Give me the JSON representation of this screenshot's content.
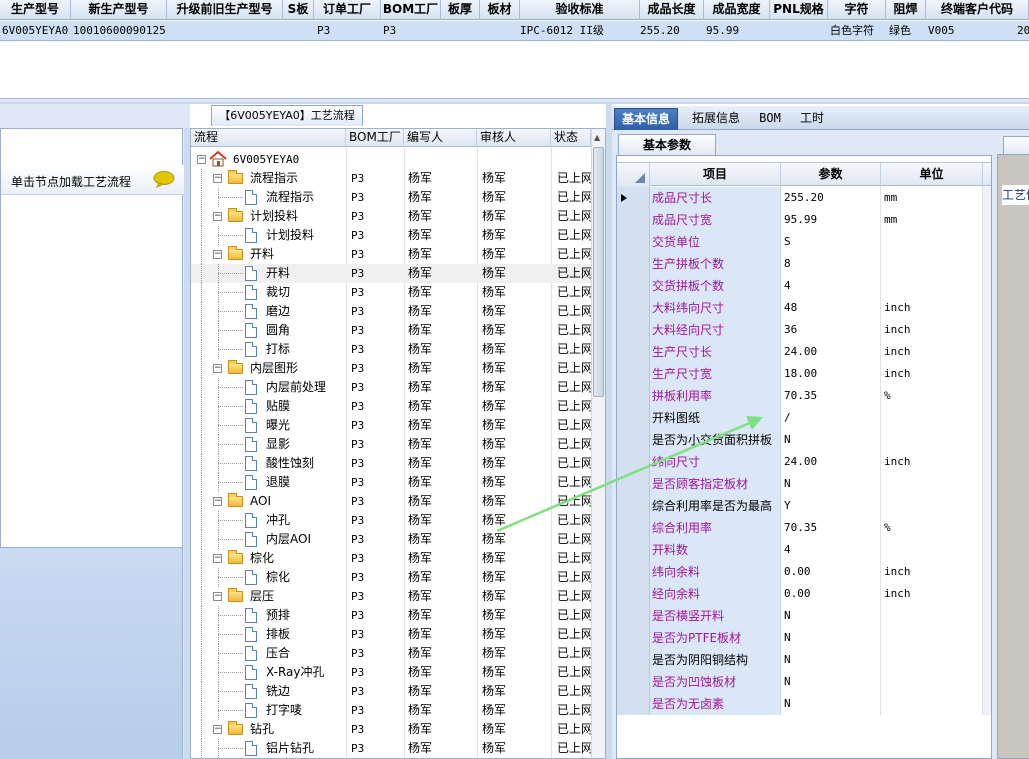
{
  "top_grid": {
    "columns": [
      "生产型号",
      "新生产型号",
      "升级前旧生产型号",
      "S板",
      "订单工厂",
      "BOM工厂",
      "板厚",
      "板材",
      "验收标准",
      "成品长度",
      "成品宽度",
      "PNL规格",
      "字符",
      "阻焊",
      "终端客户代码"
    ],
    "row": {
      "prod_model": "6V005YEYA0",
      "new_model": "10010600090125",
      "old_model": "",
      "s_board": "",
      "order_factory": "P3",
      "bom_factory": "P3",
      "thickness": "",
      "material": "",
      "standard": "IPC-6012 II级",
      "length": "255.20",
      "width": "95.99",
      "pnl": "",
      "char": "白色字符",
      "solder_mask": "绿色",
      "customer_code": "V005",
      "overflow": "20"
    }
  },
  "left_panel": {
    "load_label": "单击节点加载工艺流程",
    "icon": "chat-bubble-icon"
  },
  "process_panel": {
    "title": "【6V005YEYA0】工艺流程",
    "columns": [
      "流程",
      "BOM工厂",
      "编写人",
      "审核人",
      "状态"
    ],
    "root_label": "6V005YEYA0",
    "rows": [
      {
        "label": "流程指示",
        "level": 1,
        "bom": "P3",
        "author": "杨军",
        "reviewer": "杨军",
        "status": "已上网"
      },
      {
        "label": "流程指示",
        "level": 2,
        "bom": "P3",
        "author": "杨军",
        "reviewer": "杨军",
        "status": "已上网"
      },
      {
        "label": "计划投料",
        "level": 1,
        "bom": "P3",
        "author": "杨军",
        "reviewer": "杨军",
        "status": "已上网"
      },
      {
        "label": "计划投料",
        "level": 2,
        "bom": "P3",
        "author": "杨军",
        "reviewer": "杨军",
        "status": "已上网"
      },
      {
        "label": "开料",
        "level": 1,
        "bom": "P3",
        "author": "杨军",
        "reviewer": "杨军",
        "status": "已上网"
      },
      {
        "label": "开料",
        "level": 2,
        "bom": "P3",
        "author": "杨军",
        "reviewer": "杨军",
        "status": "已上网",
        "selected": true
      },
      {
        "label": "裁切",
        "level": 2,
        "bom": "P3",
        "author": "杨军",
        "reviewer": "杨军",
        "status": "已上网"
      },
      {
        "label": "磨边",
        "level": 2,
        "bom": "P3",
        "author": "杨军",
        "reviewer": "杨军",
        "status": "已上网"
      },
      {
        "label": "圆角",
        "level": 2,
        "bom": "P3",
        "author": "杨军",
        "reviewer": "杨军",
        "status": "已上网"
      },
      {
        "label": "打标",
        "level": 2,
        "bom": "P3",
        "author": "杨军",
        "reviewer": "杨军",
        "status": "已上网"
      },
      {
        "label": "内层图形",
        "level": 1,
        "bom": "P3",
        "author": "杨军",
        "reviewer": "杨军",
        "status": "已上网"
      },
      {
        "label": "内层前处理",
        "level": 2,
        "bom": "P3",
        "author": "杨军",
        "reviewer": "杨军",
        "status": "已上网"
      },
      {
        "label": "贴膜",
        "level": 2,
        "bom": "P3",
        "author": "杨军",
        "reviewer": "杨军",
        "status": "已上网"
      },
      {
        "label": "曝光",
        "level": 2,
        "bom": "P3",
        "author": "杨军",
        "reviewer": "杨军",
        "status": "已上网"
      },
      {
        "label": "显影",
        "level": 2,
        "bom": "P3",
        "author": "杨军",
        "reviewer": "杨军",
        "status": "已上网"
      },
      {
        "label": "酸性蚀刻",
        "level": 2,
        "bom": "P3",
        "author": "杨军",
        "reviewer": "杨军",
        "status": "已上网"
      },
      {
        "label": "退膜",
        "level": 2,
        "bom": "P3",
        "author": "杨军",
        "reviewer": "杨军",
        "status": "已上网"
      },
      {
        "label": "AOI",
        "level": 1,
        "bom": "P3",
        "author": "杨军",
        "reviewer": "杨军",
        "status": "已上网"
      },
      {
        "label": "冲孔",
        "level": 2,
        "bom": "P3",
        "author": "杨军",
        "reviewer": "杨军",
        "status": "已上网"
      },
      {
        "label": "内层AOI",
        "level": 2,
        "bom": "P3",
        "author": "杨军",
        "reviewer": "杨军",
        "status": "已上网"
      },
      {
        "label": "棕化",
        "level": 1,
        "bom": "P3",
        "author": "杨军",
        "reviewer": "杨军",
        "status": "已上网"
      },
      {
        "label": "棕化",
        "level": 2,
        "bom": "P3",
        "author": "杨军",
        "reviewer": "杨军",
        "status": "已上网"
      },
      {
        "label": "层压",
        "level": 1,
        "bom": "P3",
        "author": "杨军",
        "reviewer": "杨军",
        "status": "已上网"
      },
      {
        "label": "预排",
        "level": 2,
        "bom": "P3",
        "author": "杨军",
        "reviewer": "杨军",
        "status": "已上网"
      },
      {
        "label": "排板",
        "level": 2,
        "bom": "P3",
        "author": "杨军",
        "reviewer": "杨军",
        "status": "已上网"
      },
      {
        "label": "压合",
        "level": 2,
        "bom": "P3",
        "author": "杨军",
        "reviewer": "杨军",
        "status": "已上网"
      },
      {
        "label": "X-Ray冲孔",
        "level": 2,
        "bom": "P3",
        "author": "杨军",
        "reviewer": "杨军",
        "status": "已上网"
      },
      {
        "label": "铣边",
        "level": 2,
        "bom": "P3",
        "author": "杨军",
        "reviewer": "杨军",
        "status": "已上网"
      },
      {
        "label": "打字唛",
        "level": 2,
        "bom": "P3",
        "author": "杨军",
        "reviewer": "杨军",
        "status": "已上网"
      },
      {
        "label": "钻孔",
        "level": 1,
        "bom": "P3",
        "author": "杨军",
        "reviewer": "杨军",
        "status": "已上网"
      },
      {
        "label": "铝片钻孔",
        "level": 2,
        "bom": "P3",
        "author": "杨军",
        "reviewer": "杨军",
        "status": "已上网"
      }
    ]
  },
  "right_tabs": [
    "基本信息",
    "拓展信息",
    "BOM",
    "工时"
  ],
  "basic_params": {
    "tab_label": "基本参数",
    "columns": [
      "项目",
      "参数",
      "单位"
    ],
    "rows": [
      {
        "name": "成品尺寸长",
        "value": "255.20",
        "unit": "mm",
        "purple": true
      },
      {
        "name": "成品尺寸宽",
        "value": "95.99",
        "unit": "mm",
        "purple": true
      },
      {
        "name": "交货单位",
        "value": "S",
        "unit": "",
        "purple": true
      },
      {
        "name": "生产拼板个数",
        "value": "8",
        "unit": "",
        "purple": true
      },
      {
        "name": "交货拼板个数",
        "value": "4",
        "unit": "",
        "purple": true
      },
      {
        "name": "大料纬向尺寸",
        "value": "48",
        "unit": "inch",
        "purple": true
      },
      {
        "name": "大料经向尺寸",
        "value": "36",
        "unit": "inch",
        "purple": true
      },
      {
        "name": "生产尺寸长",
        "value": "24.00",
        "unit": "inch",
        "purple": true
      },
      {
        "name": "生产尺寸宽",
        "value": "18.00",
        "unit": "inch",
        "purple": true
      },
      {
        "name": "拼板利用率",
        "value": "70.35",
        "unit": "%",
        "purple": true
      },
      {
        "name": "开料图纸",
        "value": "/",
        "unit": "",
        "purple": false
      },
      {
        "name": "是否为小交货面积拼板",
        "value": "N",
        "unit": "",
        "purple": false
      },
      {
        "name": "纬向尺寸",
        "value": "24.00",
        "unit": "inch",
        "purple": true
      },
      {
        "name": "是否顾客指定板材",
        "value": "N",
        "unit": "",
        "purple": true
      },
      {
        "name": "综合利用率是否为最高",
        "value": "Y",
        "unit": "",
        "purple": false
      },
      {
        "name": "综合利用率",
        "value": "70.35",
        "unit": "%",
        "purple": true
      },
      {
        "name": "开料数",
        "value": "4",
        "unit": "",
        "purple": true
      },
      {
        "name": "纬向余料",
        "value": "0.00",
        "unit": "inch",
        "purple": true
      },
      {
        "name": "经向余料",
        "value": "0.00",
        "unit": "inch",
        "purple": true
      },
      {
        "name": "是否横竖开料",
        "value": "N",
        "unit": "",
        "purple": true
      },
      {
        "name": "是否为PTFE板材",
        "value": "N",
        "unit": "",
        "purple": true
      },
      {
        "name": "是否为阴阳铜结构",
        "value": "N",
        "unit": "",
        "purple": false
      },
      {
        "name": "是否为凹蚀板材",
        "value": "N",
        "unit": "",
        "purple": true
      },
      {
        "name": "是否为无卤素",
        "value": "N",
        "unit": "",
        "purple": true
      }
    ]
  },
  "far_right": {
    "label": "工艺信"
  },
  "colors": {
    "accent": "#2e60a8",
    "purple_label": "#a0169a",
    "selected_row": "#cfe0f6",
    "arrow": "#7ee07e"
  }
}
